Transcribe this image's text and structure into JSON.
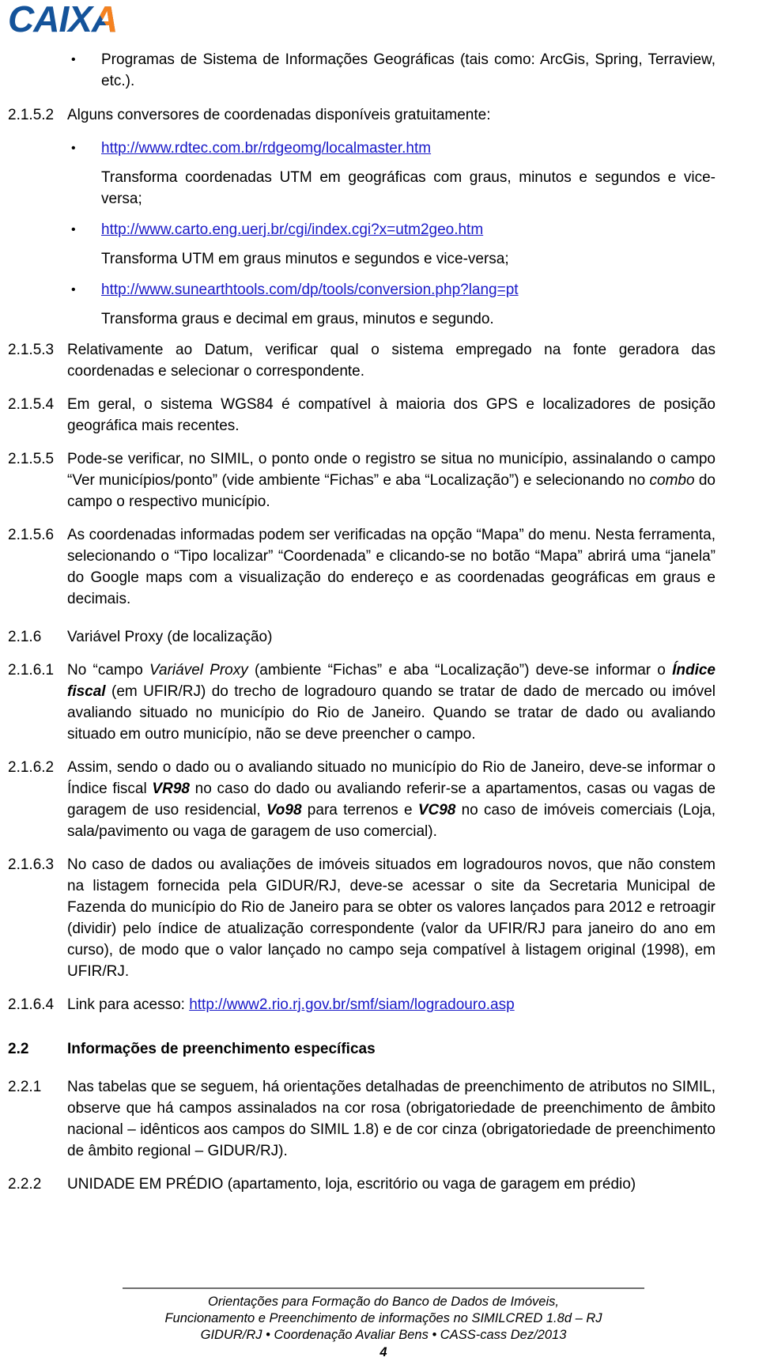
{
  "logo": {
    "brand": "CAIXA",
    "blue": "#14539A",
    "orange": "#F58220"
  },
  "bullet_glyph": "•",
  "content": {
    "b_programas": "Programas de Sistema de Informações Geográficas (tais como: ArcGis, Spring, Terraview, etc.).",
    "n_2152": "2.1.5.2",
    "t_2152": "Alguns conversores de coordenadas disponíveis gratuitamente:",
    "link1": "http://www.rdtec.com.br/rdgeomg/localmaster.htm",
    "desc1": "Transforma coordenadas UTM em geográficas com graus, minutos e segundos e vice-versa;",
    "link2": "http://www.carto.eng.uerj.br/cgi/index.cgi?x=utm2geo.htm",
    "desc2": "Transforma UTM em graus minutos e segundos e vice-versa;",
    "link3": "http://www.sunearthtools.com/dp/tools/conversion.php?lang=pt",
    "desc3": "Transforma graus e decimal em graus, minutos e segundo.",
    "n_2153": "2.1.5.3",
    "t_2153": "Relativamente ao Datum, verificar qual o sistema empregado na fonte geradora das coordenadas e selecionar o correspondente.",
    "n_2154": "2.1.5.4",
    "t_2154": "Em geral, o sistema WGS84 é compatível à maioria dos GPS e localizadores de posição geográfica mais recentes.",
    "n_2155": "2.1.5.5",
    "t_2155_a": "Pode-se verificar, no SIMIL, o ponto onde o registro se situa no município, assinalando o campo “Ver municípios/ponto” (vide ambiente “Fichas” e aba “Localização”) e selecionando no ",
    "t_2155_it": "combo",
    "t_2155_b": " do campo o respectivo município.",
    "n_2156": "2.1.5.6",
    "t_2156": "As coordenadas informadas podem ser verificadas na opção “Mapa” do menu.  Nesta ferramenta, selecionando o “Tipo localizar” “Coordenada” e clicando-se no botão “Mapa” abrirá uma “janela” do Google maps com a visualização do endereço e as coordenadas geográficas em graus e decimais.",
    "n_216": "2.1.6",
    "t_216": "Variável Proxy (de localização)",
    "n_2161": "2.1.6.1",
    "t_2161_a": "No “campo ",
    "t_2161_it1": "Variável Proxy",
    "t_2161_b": " (ambiente “Fichas” e aba “Localização”) deve-se informar o ",
    "t_2161_bi": "Índice fiscal",
    "t_2161_c": " (em UFIR/RJ) do trecho de logradouro quando se tratar de dado de mercado ou imóvel avaliando situado no município do Rio de Janeiro. Quando se tratar de dado ou avaliando situado em outro município, não se deve preencher o campo.",
    "n_2162": "2.1.6.2",
    "t_2162_a": "Assim, sendo o dado ou o avaliando situado no município do Rio de Janeiro, deve-se informar o Índice fiscal ",
    "t_2162_bi1": "VR98",
    "t_2162_b": " no caso do dado ou avaliando referir-se a apartamentos, casas ou vagas de garagem de uso residencial, ",
    "t_2162_bi2": "Vo98",
    "t_2162_c": " para terrenos e ",
    "t_2162_bi3": "VC98",
    "t_2162_d": " no caso de imóveis comerciais (Loja, sala/pavimento ou vaga de garagem de uso comercial).",
    "n_2163": "2.1.6.3",
    "t_2163": "No caso de dados ou avaliações de imóveis situados em logradouros novos, que não constem na listagem fornecida pela GIDUR/RJ, deve-se acessar o site da Secretaria Municipal de Fazenda do município do Rio de Janeiro para se obter os valores lançados para 2012 e retroagir (dividir) pelo índice de atualização correspondente (valor da UFIR/RJ para janeiro do ano em curso), de modo que o valor lançado no campo seja compatível à listagem original (1998), em UFIR/RJ.",
    "n_2164": "2.1.6.4",
    "t_2164_a": "Link para acesso: ",
    "link4": "http://www2.rio.rj.gov.br/smf/siam/logradouro.asp",
    "n_22": "2.2",
    "t_22": "Informações de preenchimento específicas",
    "n_221": "2.2.1",
    "t_221": "Nas tabelas que se seguem, há orientações detalhadas de preenchimento de atributos no SIMIL, observe que há campos assinalados na cor rosa (obrigatoriedade de preenchimento de âmbito nacional – idênticos aos campos do SIMIL 1.8) e de cor cinza (obrigatoriedade de preenchimento de âmbito regional – GIDUR/RJ).",
    "n_222": "2.2.2",
    "t_222": "UNIDADE EM PRÉDIO (apartamento, loja, escritório ou vaga de garagem em prédio)"
  },
  "footer": {
    "line1": "Orientações para Formação do Banco de Dados de Imóveis,",
    "line2": "Funcionamento e Preenchimento de informações no SIMILCRED 1.8d  – RJ",
    "line3": "GIDUR/RJ • Coordenação Avaliar Bens • CASS-cass Dez/2013",
    "page_number": "4"
  }
}
